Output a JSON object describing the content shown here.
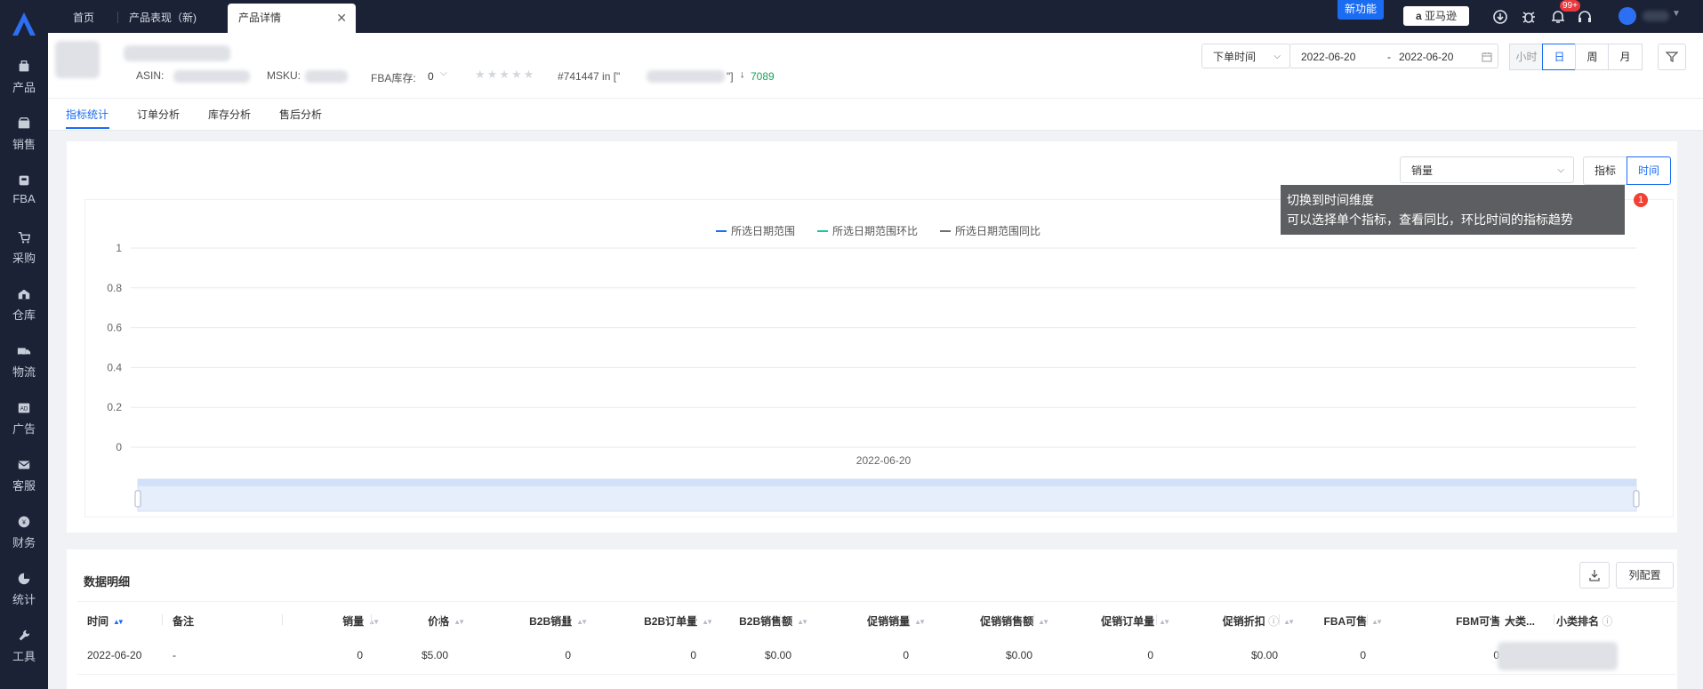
{
  "topbar": {
    "tabs": [
      "首页",
      "产品表现（新)",
      "产品详情"
    ],
    "new_feature": "新功能",
    "amazon": "亚马逊",
    "notif_badge": "99+"
  },
  "sidebar": [
    "产品",
    "销售",
    "FBA",
    "采购",
    "仓库",
    "物流",
    "广告",
    "客服",
    "财务",
    "统计",
    "工具"
  ],
  "product": {
    "asin_label": "ASIN:",
    "msku_label": "MSKU:",
    "fba_label": "FBA库存:",
    "fba_value": "0",
    "rank_prefix": "#741447 in [\"",
    "rank_suffix": "\"]",
    "rank_change": "7089"
  },
  "date_filter": {
    "type": "下单时间",
    "start": "2022-06-20",
    "separator": "-",
    "end": "2022-06-20",
    "granularity": [
      "小时",
      "日",
      "周",
      "月"
    ]
  },
  "subtabs": [
    "指标统计",
    "订单分析",
    "库存分析",
    "售后分析"
  ],
  "chart_controls": {
    "metric": "销量",
    "mode_buttons": [
      "指标",
      "时间"
    ]
  },
  "tooltip": {
    "line1": "切换到时间维度",
    "line2": "可以选择单个指标，查看同比，环比时间的指标趋势",
    "step": "1"
  },
  "chart_data": {
    "type": "line",
    "x": [
      "2022-06-20"
    ],
    "series": [
      {
        "name": "所选日期范围",
        "values": [
          0
        ]
      },
      {
        "name": "所选日期范围环比",
        "values": [
          0
        ]
      },
      {
        "name": "所选日期范围同比",
        "values": [
          0
        ]
      }
    ],
    "ylim": [
      0,
      1
    ],
    "yticks": [
      "1",
      "0.8",
      "0.6",
      "0.4",
      "0.2",
      "0"
    ],
    "legend": "top-center",
    "grid": true,
    "colors": [
      "#1a6cf3",
      "#14c9a0",
      "#6b6f7a"
    ]
  },
  "detail": {
    "title": "数据明细",
    "col_config": "列配置",
    "columns": [
      "时间",
      "备注",
      "销量",
      "价格",
      "B2B销量",
      "B2B订单量",
      "B2B销售额",
      "促销销量",
      "促销销售额",
      "促销订单量",
      "促销折扣",
      "FBA可售",
      "FBM可售",
      "大类...",
      "小类排名"
    ],
    "rows": [
      [
        "2022-06-20",
        "-",
        "0",
        "$5.00",
        "0",
        "0",
        "$0.00",
        "0",
        "$0.00",
        "0",
        "$0.00",
        "0",
        "0"
      ]
    ]
  }
}
